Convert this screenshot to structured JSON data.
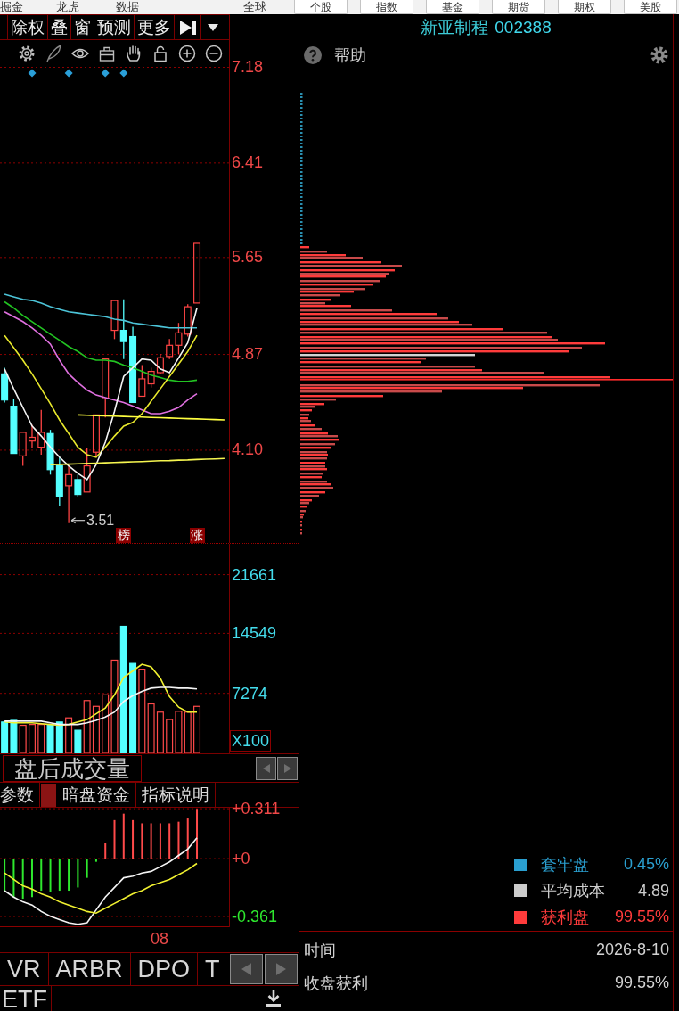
{
  "top_bar": {
    "links": [
      "掘金",
      "龙虎",
      "数据",
      "全球"
    ],
    "buttons": [
      "个股",
      "指数",
      "基金",
      "期货",
      "期权",
      "美股"
    ]
  },
  "toolbar": {
    "buttons": [
      "除权",
      "叠",
      "窗",
      "预测",
      "更多"
    ]
  },
  "price_chart": {
    "low_label": "3.51",
    "markers": [
      "榜",
      "涨"
    ],
    "chart_data": {
      "type": "candlestick",
      "grid": true,
      "ylim": [
        3.35,
        7.18
      ],
      "yticks": [
        {
          "value": 7.18,
          "label": "7.18"
        },
        {
          "value": 6.41,
          "label": "6.41"
        },
        {
          "value": 5.65,
          "label": "5.65"
        },
        {
          "value": 4.87,
          "label": "4.87"
        },
        {
          "value": 4.1,
          "label": "4.10"
        }
      ],
      "ohlc": [
        [
          4.71,
          4.76,
          4.48,
          4.5
        ],
        [
          4.45,
          4.51,
          4.07,
          4.07
        ],
        [
          4.05,
          4.24,
          3.97,
          4.24
        ],
        [
          4.17,
          4.3,
          4.11,
          4.2
        ],
        [
          4.12,
          4.42,
          4.06,
          4.24
        ],
        [
          4.23,
          4.26,
          3.9,
          3.94
        ],
        [
          3.97,
          4.04,
          3.65,
          3.72
        ],
        [
          3.81,
          3.97,
          3.51,
          3.9
        ],
        [
          3.86,
          3.9,
          3.72,
          3.74
        ],
        [
          3.76,
          4.11,
          3.76,
          3.97
        ],
        [
          4.08,
          4.38,
          4.04,
          4.38
        ],
        [
          4.51,
          4.83,
          4.36,
          4.83
        ],
        [
          5.06,
          5.3,
          4.99,
          5.3
        ],
        [
          5.06,
          5.31,
          4.83,
          4.97
        ],
        [
          5.01,
          5.09,
          4.48,
          4.48
        ],
        [
          4.53,
          4.78,
          4.53,
          4.67
        ],
        [
          4.63,
          4.76,
          4.6,
          4.73
        ],
        [
          4.72,
          4.87,
          4.71,
          4.84
        ],
        [
          4.85,
          4.99,
          4.83,
          4.94
        ],
        [
          4.94,
          5.12,
          4.87,
          5.04
        ],
        [
          5.03,
          5.27,
          5.01,
          5.25
        ],
        [
          5.28,
          5.76,
          5.28,
          5.76
        ],
        null,
        null,
        null
      ],
      "series": [
        {
          "type": "line",
          "color": "#4cc4d8",
          "values": [
            5.35,
            5.33,
            5.31,
            5.3,
            5.28,
            5.25,
            5.23,
            5.21,
            5.2,
            5.19,
            5.18,
            5.17,
            5.15,
            5.14,
            5.12,
            5.11,
            5.1,
            5.09,
            5.08,
            5.08,
            5.08,
            5.08,
            null,
            null,
            null
          ]
        },
        {
          "type": "line",
          "color": "#22c322",
          "values": [
            5.29,
            5.24,
            5.18,
            5.13,
            5.08,
            5.03,
            4.98,
            4.93,
            4.89,
            4.84,
            4.82,
            4.82,
            4.81,
            4.78,
            4.76,
            4.73,
            4.7,
            4.68,
            4.66,
            4.65,
            4.65,
            4.66,
            null,
            null,
            null
          ]
        },
        {
          "type": "line",
          "color": "#e070e0",
          "values": [
            5.21,
            5.17,
            5.13,
            5.08,
            5.02,
            4.95,
            4.82,
            4.71,
            4.64,
            4.58,
            4.54,
            4.52,
            4.5,
            4.48,
            4.45,
            4.42,
            4.39,
            4.39,
            4.41,
            4.44,
            4.5,
            4.55,
            null,
            null,
            null
          ]
        },
        {
          "type": "line",
          "color": "#e8e82c",
          "values": [
            5.02,
            4.92,
            4.82,
            4.71,
            4.59,
            4.47,
            4.34,
            4.23,
            4.12,
            4.06,
            4.04,
            4.12,
            4.21,
            4.29,
            4.32,
            4.39,
            4.49,
            4.59,
            4.69,
            4.79,
            4.89,
            5.02,
            null,
            null,
            null
          ]
        },
        {
          "type": "line",
          "color": "#f4f4f4",
          "values": [
            4.75,
            4.59,
            4.44,
            4.29,
            4.21,
            4.12,
            4.04,
            3.97,
            3.91,
            3.86,
            3.98,
            4.16,
            4.41,
            4.69,
            4.76,
            4.83,
            4.82,
            4.75,
            4.72,
            4.84,
            4.96,
            5.24,
            null,
            null,
            null
          ]
        },
        {
          "type": "line",
          "color": "#ffff40",
          "values": [
            null,
            null,
            null,
            null,
            null,
            null,
            null,
            null,
            4.38,
            4.378,
            4.375,
            4.373,
            4.37,
            4.368,
            4.365,
            4.363,
            4.36,
            4.358,
            4.355,
            4.353,
            4.35,
            4.348,
            4.345,
            4.343,
            4.34
          ]
        },
        {
          "type": "line",
          "color": "#f6f650",
          "values": [
            null,
            null,
            null,
            null,
            null,
            3.979,
            3.982,
            3.984,
            3.987,
            3.99,
            3.992,
            3.995,
            3.997,
            4.0,
            4.003,
            4.005,
            4.008,
            4.011,
            4.013,
            4.016,
            4.018,
            4.021,
            4.024,
            4.026,
            4.029
          ]
        }
      ]
    }
  },
  "volume_chart": {
    "unit": "X100",
    "chart_data": {
      "type": "bar",
      "grid": true,
      "ylim": [
        0,
        25400
      ],
      "yticks": [
        {
          "value": 21661,
          "label": "21661"
        },
        {
          "value": 14549,
          "label": "14549"
        },
        {
          "value": 7274,
          "label": "7274"
        }
      ],
      "series": [
        {
          "color": "#ff4a4a",
          "values": [
            null,
            null,
            3400,
            3500,
            3500,
            null,
            null,
            4300,
            null,
            6400,
            5700,
            7100,
            11300,
            null,
            null,
            10200,
            6000,
            5000,
            4100,
            5100,
            5000,
            5700,
            null,
            null,
            null
          ]
        },
        {
          "color": "#54ffff",
          "values": [
            3800,
            4000,
            null,
            null,
            null,
            3500,
            3800,
            null,
            2800,
            null,
            null,
            null,
            null,
            15400,
            10900,
            null,
            null,
            null,
            null,
            null,
            null,
            null,
            null,
            null,
            null
          ]
        },
        {
          "type": "line",
          "color": "#f0f030",
          "values": [
            3800,
            3700,
            3700,
            3700,
            3600,
            3500,
            3400,
            3500,
            3800,
            4100,
            4800,
            5500,
            7100,
            9200,
            10000,
            10800,
            10500,
            9100,
            6900,
            5600,
            5000,
            5000,
            null,
            null,
            null
          ]
        },
        {
          "type": "line",
          "color": "#f4f4f4",
          "values": [
            3900,
            3900,
            3900,
            3900,
            3900,
            3700,
            3500,
            3500,
            3500,
            3700,
            4000,
            4400,
            5000,
            6300,
            7000,
            7500,
            7900,
            8000,
            8000,
            7900,
            7900,
            7800,
            null,
            null,
            null
          ]
        }
      ]
    }
  },
  "indicator_bar": {
    "title": "盘后成交量"
  },
  "indicator_tabs": [
    "参数",
    "暗盘资金",
    "指标说明"
  ],
  "macd_chart": {
    "chart_data": {
      "type": "bar",
      "grid": true,
      "ylim": [
        -0.422,
        0.317
      ],
      "yticks": [
        {
          "value": 0.311,
          "label": "+0.311"
        },
        {
          "value": 0,
          "label": "+0"
        },
        {
          "value": -0.361,
          "label": "-0.361"
        }
      ],
      "categories": [
        null,
        null,
        null,
        null,
        null,
        null,
        null,
        null,
        null,
        null,
        null,
        null,
        null,
        null,
        null,
        null,
        null,
        "08",
        null,
        null,
        null,
        null,
        null,
        null,
        null
      ],
      "series": [
        {
          "color": "#ff4a4a",
          "values": [
            null,
            null,
            null,
            null,
            null,
            null,
            null,
            null,
            null,
            null,
            null,
            0.1,
            0.24,
            0.28,
            0.24,
            0.22,
            0.22,
            0.22,
            0.22,
            0.23,
            0.25,
            0.31,
            null,
            null,
            null
          ]
        },
        {
          "color": "#2ee82e",
          "values": [
            -0.2,
            -0.24,
            -0.25,
            -0.24,
            -0.2,
            -0.21,
            -0.2,
            -0.2,
            -0.18,
            -0.12,
            -0.02,
            null,
            null,
            null,
            null,
            null,
            null,
            null,
            null,
            null,
            null,
            null,
            null,
            null,
            null
          ]
        },
        {
          "type": "line",
          "color": "#f4f4f4",
          "values": [
            -0.2,
            -0.24,
            -0.27,
            -0.29,
            -0.33,
            -0.36,
            -0.38,
            -0.4,
            -0.41,
            -0.4,
            -0.32,
            -0.24,
            -0.18,
            -0.12,
            -0.11,
            -0.09,
            -0.08,
            -0.05,
            -0.02,
            0.02,
            0.06,
            0.13,
            null,
            null,
            null
          ]
        },
        {
          "type": "line",
          "color": "#f0f030",
          "values": [
            -0.09,
            -0.13,
            -0.17,
            -0.19,
            -0.22,
            -0.24,
            -0.27,
            -0.29,
            -0.31,
            -0.33,
            -0.34,
            -0.31,
            -0.28,
            -0.25,
            -0.22,
            -0.2,
            -0.17,
            -0.15,
            -0.13,
            -0.1,
            -0.07,
            -0.03,
            null,
            null,
            null
          ]
        }
      ]
    }
  },
  "bottom_tabs": [
    "VR",
    "ARBR",
    "DPO",
    "T"
  ],
  "bottom_row": {
    "label": "ETF"
  },
  "chip_panel": {
    "title": {
      "name": "新亚制程",
      "code": "002388"
    },
    "help": "帮助",
    "legend": [
      {
        "label": "套牢盘",
        "value": "0.45%",
        "color": "#2a9fd0"
      },
      {
        "label": "平均成本",
        "value": "4.89",
        "color": "#cccccc"
      },
      {
        "label": "获利盘",
        "value": "99.55%",
        "color": "#ff3b3b"
      }
    ],
    "info": [
      {
        "label": "时间",
        "value": "2026-8-10"
      },
      {
        "label": "收盘获利",
        "value": "99.55%"
      }
    ]
  }
}
